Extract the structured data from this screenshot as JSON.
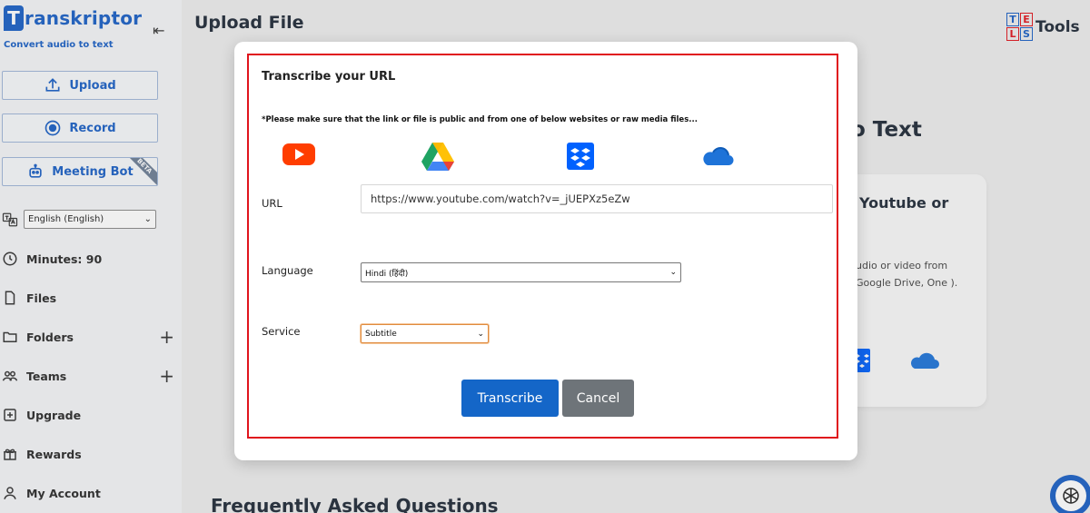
{
  "brand": {
    "logo_letter": "T",
    "name": "ranskriptor",
    "tagline": "Convert audio to text"
  },
  "sidebar": {
    "upload_label": "Upload",
    "record_label": "Record",
    "meeting_bot_label": "Meeting Bot",
    "meeting_bot_badge": "BETA",
    "language_selected": "English (English)",
    "items": [
      {
        "label": "Minutes: 90"
      },
      {
        "label": "Files"
      },
      {
        "label": "Folders"
      },
      {
        "label": "Teams"
      },
      {
        "label": "Upgrade"
      },
      {
        "label": "Rewards"
      },
      {
        "label": "My Account"
      }
    ]
  },
  "header": {
    "title": "Upload File",
    "tools_letters": [
      "T",
      "E",
      "L",
      "S"
    ],
    "tools_label": "Tools"
  },
  "background": {
    "heading": "o Text",
    "card_title": "Youtube or",
    "card_text": "udio or video from Google Drive, One ).",
    "faq_heading": "Frequently Asked Questions"
  },
  "modal": {
    "title": "Transcribe your URL",
    "note": "*Please make sure that the link or file is public and from one of below websites or raw media files...",
    "sources": [
      "youtube-icon",
      "google-drive-icon",
      "dropbox-icon",
      "onedrive-icon"
    ],
    "url_label": "URL",
    "url_value": "https://www.youtube.com/watch?v=_jUEPXz5eZw",
    "language_label": "Language",
    "language_value": "Hindi (हिंदी)",
    "service_label": "Service",
    "service_value": "Subtitle",
    "transcribe_label": "Transcribe",
    "cancel_label": "Cancel"
  },
  "colors": {
    "brand_blue": "#1a5fc4",
    "primary_button": "#1466c8",
    "cancel_button": "#6e7479",
    "highlight_frame": "#e0141c"
  }
}
